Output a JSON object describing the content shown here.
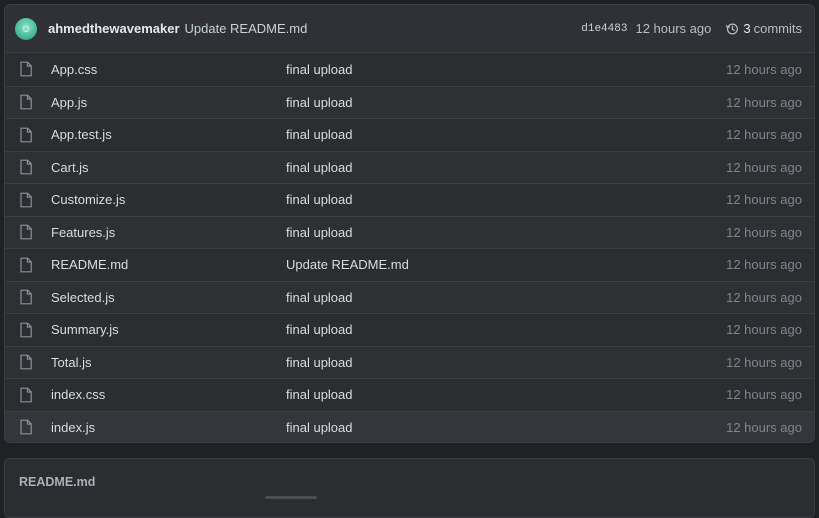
{
  "commit": {
    "author": "ahmedthewavemaker",
    "message": "Update README.md",
    "sha": "d1e4483",
    "time": "12 hours ago",
    "commits_count": "3",
    "commits_label": "commits"
  },
  "files": [
    {
      "name": "App.css",
      "message": "final upload",
      "age": "12 hours ago"
    },
    {
      "name": "App.js",
      "message": "final upload",
      "age": "12 hours ago"
    },
    {
      "name": "App.test.js",
      "message": "final upload",
      "age": "12 hours ago"
    },
    {
      "name": "Cart.js",
      "message": "final upload",
      "age": "12 hours ago"
    },
    {
      "name": "Customize.js",
      "message": "final upload",
      "age": "12 hours ago"
    },
    {
      "name": "Features.js",
      "message": "final upload",
      "age": "12 hours ago"
    },
    {
      "name": "README.md",
      "message": "Update README.md",
      "age": "12 hours ago"
    },
    {
      "name": "Selected.js",
      "message": "final upload",
      "age": "12 hours ago"
    },
    {
      "name": "Summary.js",
      "message": "final upload",
      "age": "12 hours ago"
    },
    {
      "name": "Total.js",
      "message": "final upload",
      "age": "12 hours ago"
    },
    {
      "name": "index.css",
      "message": "final upload",
      "age": "12 hours ago"
    },
    {
      "name": "index.js",
      "message": "final upload",
      "age": "12 hours ago"
    }
  ],
  "readme": {
    "title": "README.md"
  },
  "icons": {
    "file": "file-icon",
    "history": "history-icon",
    "avatar": "avatar"
  }
}
